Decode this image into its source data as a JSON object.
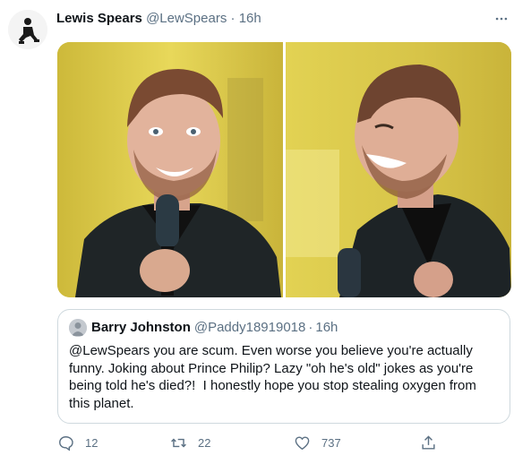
{
  "tweet": {
    "author_name": "Lewis Spears",
    "author_handle": "@LewSpears",
    "separator": "·",
    "time": "16h",
    "more_icon": "more-horizontal-icon",
    "avatar_icon": "avatar-figure",
    "media": [
      {
        "name": "photo-comedian-smiling"
      },
      {
        "name": "photo-comedian-laughing"
      }
    ]
  },
  "quote": {
    "author_name": "Barry Johnston",
    "author_handle": "@Paddy18919018",
    "separator": "·",
    "time": "16h",
    "text": "@LewSpears you are scum. Even worse you believe you're actually\nfunny. Joking about Prince Philip? Lazy \"oh he's old\" jokes as you're\nbeing told he's died?!  I honestly hope you stop stealing oxygen from\nthis planet."
  },
  "actions": {
    "reply_count": "12",
    "retweet_count": "22",
    "like_count": "737",
    "icons": [
      "reply-icon",
      "retweet-icon",
      "like-icon",
      "share-icon"
    ]
  },
  "colors": {
    "text": "#0f1419",
    "secondary": "#5b7083",
    "border": "#cfd9de",
    "photo_background": "#d9c84a"
  }
}
